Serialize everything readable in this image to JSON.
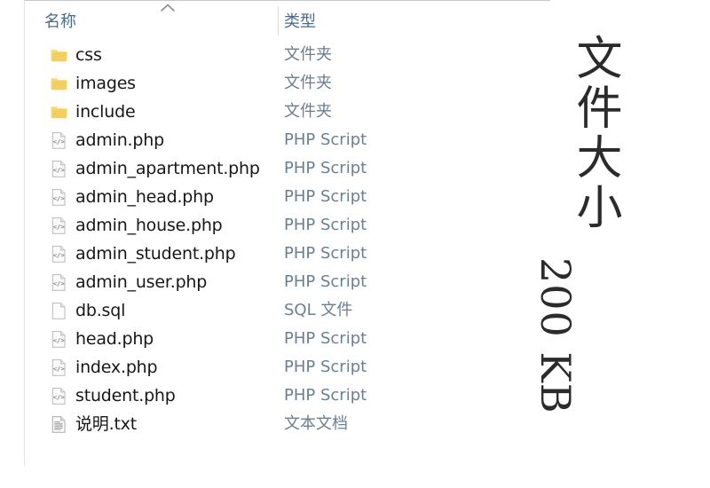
{
  "window": {
    "view_mode": "details-list"
  },
  "columns": {
    "name_header": "名称",
    "type_header": "类型",
    "sort_icon": "chevron-up-icon",
    "sort_direction": "ascending"
  },
  "files": [
    {
      "name": "css",
      "type": "文件夹",
      "icon": "folder-icon"
    },
    {
      "name": "images",
      "type": "文件夹",
      "icon": "folder-icon"
    },
    {
      "name": "include",
      "type": "文件夹",
      "icon": "folder-icon"
    },
    {
      "name": "admin.php",
      "type": "PHP Script",
      "icon": "php-script-file-icon"
    },
    {
      "name": "admin_apartment.php",
      "type": "PHP Script",
      "icon": "php-script-file-icon"
    },
    {
      "name": "admin_head.php",
      "type": "PHP Script",
      "icon": "php-script-file-icon"
    },
    {
      "name": "admin_house.php",
      "type": "PHP Script",
      "icon": "php-script-file-icon"
    },
    {
      "name": "admin_student.php",
      "type": "PHP Script",
      "icon": "php-script-file-icon"
    },
    {
      "name": "admin_user.php",
      "type": "PHP Script",
      "icon": "php-script-file-icon"
    },
    {
      "name": "db.sql",
      "type": "SQL 文件",
      "icon": "blank-document-icon"
    },
    {
      "name": "head.php",
      "type": "PHP Script",
      "icon": "php-script-file-icon"
    },
    {
      "name": "index.php",
      "type": "PHP Script",
      "icon": "php-script-file-icon"
    },
    {
      "name": "student.php",
      "type": "PHP Script",
      "icon": "php-script-file-icon"
    },
    {
      "name": "说明.txt",
      "type": "文本文档",
      "icon": "text-document-icon"
    }
  ],
  "size_annotation": {
    "label": "文件大小",
    "value": "200 KB"
  },
  "colors": {
    "folder": "#f2d06b",
    "header_text": "#4a6b8a",
    "type_text": "#6b7f92",
    "name_text": "#171717",
    "border": "#e4e4e4"
  }
}
